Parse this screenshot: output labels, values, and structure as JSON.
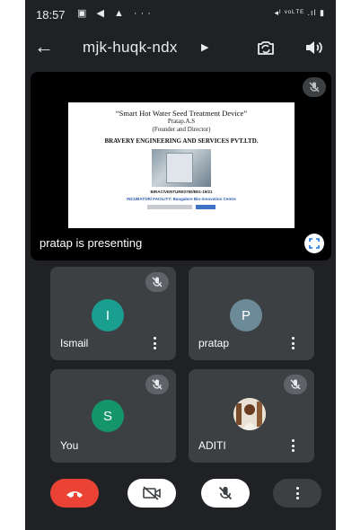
{
  "status_bar": {
    "time": "18:57",
    "notification_icons": "▣ ◀ ▲ ···",
    "right_text": "◂ᴵ ᵛᵒᴸᵀᴱ .ıl ▮"
  },
  "top_bar": {
    "back_icon": "back-arrow-icon",
    "meeting_code": "mjk-huqk-ndx",
    "expand_icon": "caret-right-icon",
    "switch_camera_icon": "switch-camera-icon",
    "speaker_icon": "speaker-icon"
  },
  "presentation": {
    "presenter_label": "pratap is presenting",
    "slide": {
      "title": "“Smart Hot Water Seed Treatment Device”",
      "name": "Pratap.A.S",
      "role": "(Founder and Director)",
      "company": "BRAVERY ENGINEERING AND SERVICES PVT.LTD.",
      "code": "BIRAC/VENTURE0780/BIG-19/21",
      "incubator": "INCUBATOR/ FACILITY:  Bangalore Bio-innovation Centre"
    },
    "fullscreen_icon": "fullscreen-icon",
    "mute_icon": "mic-off-icon"
  },
  "participants": [
    {
      "name": "Ismail",
      "initial": "I",
      "avatar_color": "#1a9e8f",
      "muted": true
    },
    {
      "name": "pratap",
      "initial": "P",
      "avatar_color": "#6d8a99",
      "muted": false
    },
    {
      "name": "You",
      "initial": "S",
      "avatar_color": "#15966a",
      "muted": true
    },
    {
      "name": "ADITI",
      "initial": "",
      "avatar_color": "#c9a86b",
      "muted": true,
      "photo": true
    }
  ],
  "controls": {
    "end_call": {
      "icon": "end-call-icon",
      "color": "#ea4335"
    },
    "camera": {
      "icon": "camera-off-icon"
    },
    "mic": {
      "icon": "mic-off-icon"
    },
    "more": {
      "icon": "more-vertical-icon"
    }
  },
  "colors": {
    "background": "#202124",
    "tile": "#3c4043",
    "chip": "#5f6368"
  }
}
